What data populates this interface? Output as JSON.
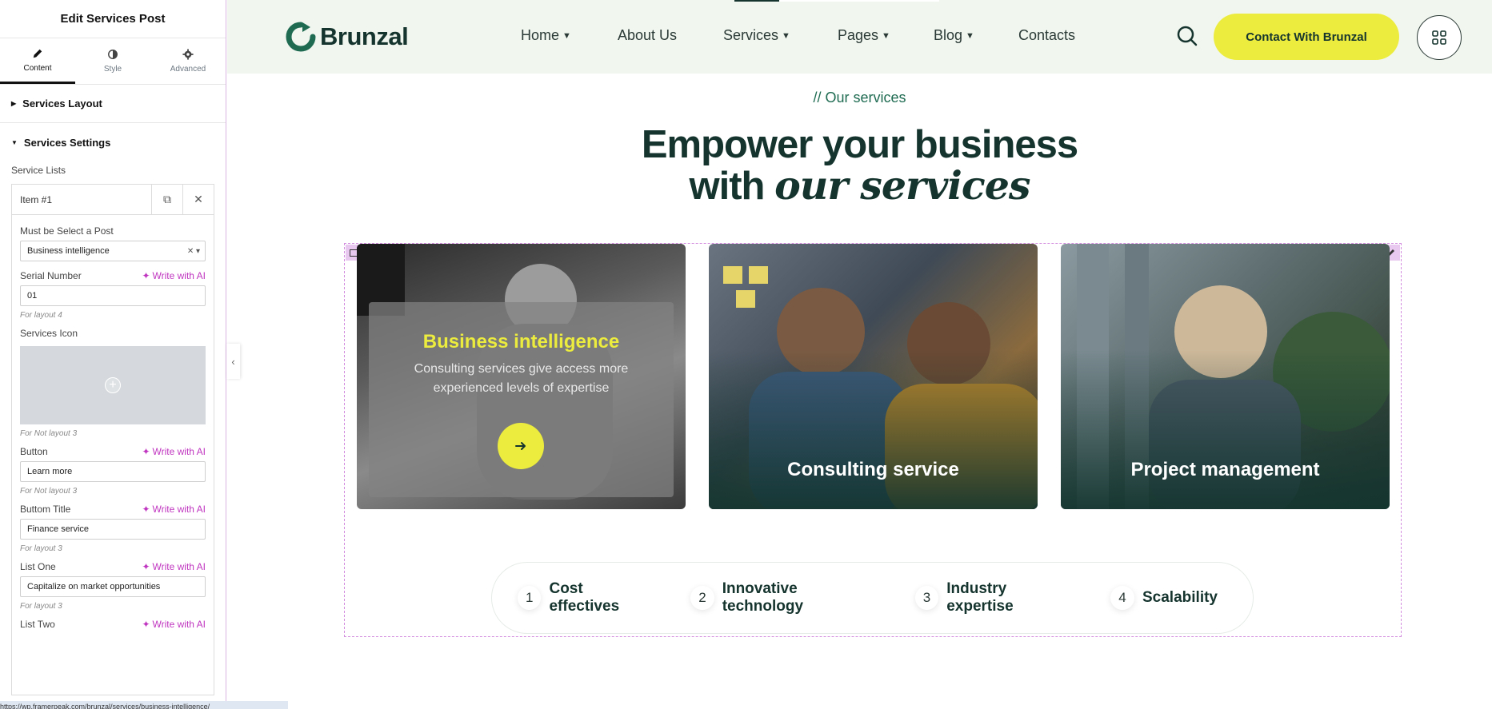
{
  "panel": {
    "title": "Edit Services Post",
    "tabs": [
      {
        "label": "Content",
        "icon": "pencil-icon"
      },
      {
        "label": "Style",
        "icon": "half-circle-icon"
      },
      {
        "label": "Advanced",
        "icon": "gear-icon"
      }
    ],
    "sections": {
      "layout": "Services Layout",
      "settings": "Services Settings"
    },
    "service_lists_label": "Service Lists",
    "item_title": "Item #1",
    "fields": {
      "select_post_label": "Must be Select a Post",
      "select_post_value": "Business intelligence",
      "serial_label": "Serial Number",
      "serial_value": "01",
      "serial_note": "For layout 4",
      "icon_label": "Services Icon",
      "icon_note": "For Not layout 3",
      "button_label": "Button",
      "button_value": "Learn more",
      "button_note": "For Not layout 3",
      "button_title_label": "Buttom Title",
      "button_title_value": "Finance service",
      "button_title_note": "For layout 3",
      "list_one_label": "List One",
      "list_one_value": "Capitalize on market opportunities",
      "list_one_note": "For layout 3",
      "list_two_label": "List Two"
    },
    "write_ai": "Write with AI",
    "status_url": "https://wp.framerpeak.com/brunzal/services/business-intelligence/"
  },
  "header": {
    "logo": "Brunzal",
    "nav": [
      {
        "label": "Home",
        "dropdown": true
      },
      {
        "label": "About Us",
        "dropdown": false
      },
      {
        "label": "Services",
        "dropdown": true
      },
      {
        "label": "Pages",
        "dropdown": true
      },
      {
        "label": "Blog",
        "dropdown": true
      },
      {
        "label": "Contacts",
        "dropdown": false
      }
    ],
    "cta": "Contact With Brunzal"
  },
  "section": {
    "eyebrow": "// Our services",
    "headline_line1": "Empower your business",
    "headline_line2_plain": "with ",
    "headline_line2_italic": "our services"
  },
  "cards": [
    {
      "title": "Business intelligence",
      "description": "Consulting services give access more experienced levels of expertise"
    },
    {
      "title": "Consulting service"
    },
    {
      "title": "Project management"
    }
  ],
  "features": [
    {
      "num": "1",
      "label": "Cost effectives"
    },
    {
      "num": "2",
      "label": "Innovative technology"
    },
    {
      "num": "3",
      "label": "Industry expertise"
    },
    {
      "num": "4",
      "label": "Scalability"
    }
  ],
  "colors": {
    "brand_dark": "#15342d",
    "accent_yellow": "#ecec3e",
    "header_bg": "#f1f6ef",
    "ai_purple": "#c036c0"
  }
}
